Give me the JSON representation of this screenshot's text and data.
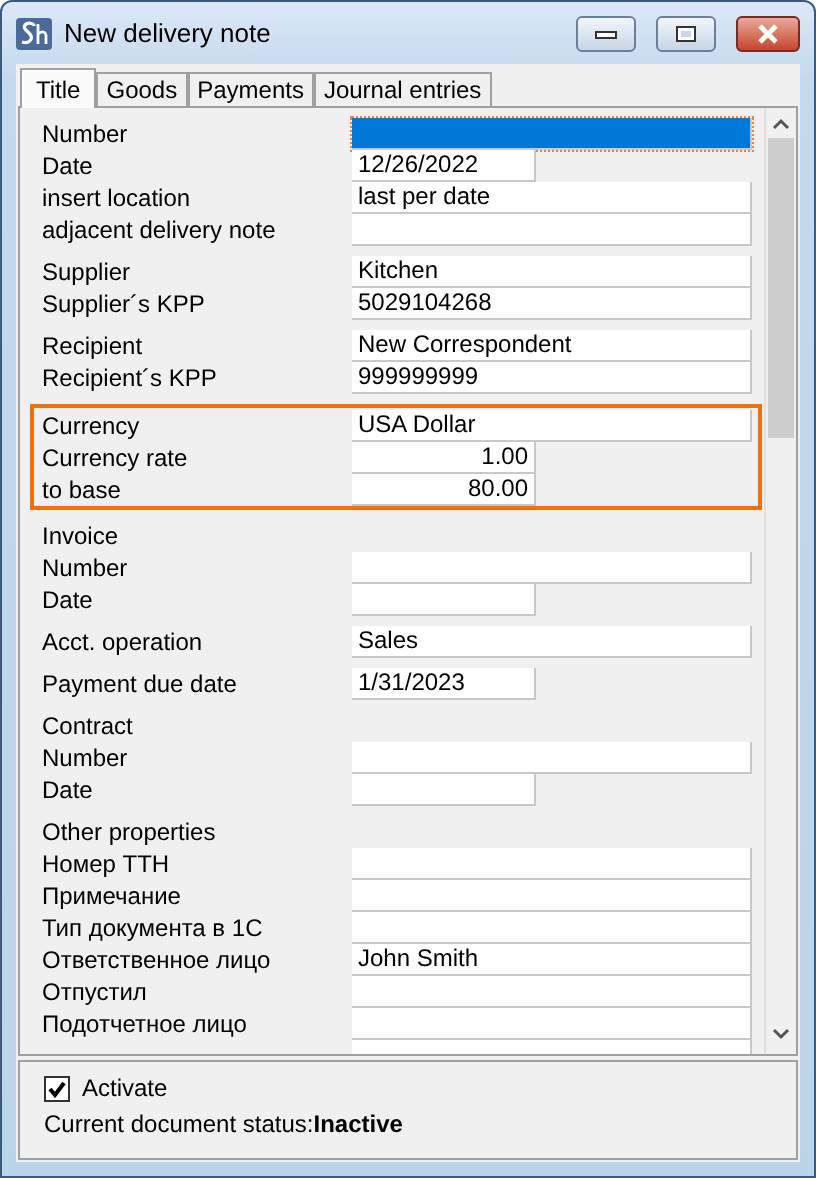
{
  "window": {
    "title": "New delivery note"
  },
  "tabs": [
    {
      "label": "Title",
      "selected": true
    },
    {
      "label": "Goods",
      "selected": false
    },
    {
      "label": "Payments",
      "selected": false
    },
    {
      "label": "Journal entries",
      "selected": false
    }
  ],
  "groups": [
    {
      "highlighted": false,
      "rows": [
        {
          "label": "Number",
          "value": "",
          "kind": "wide",
          "focused": true
        },
        {
          "label": "Date",
          "value": "12/26/2022",
          "kind": "short",
          "focused": false
        },
        {
          "label": "insert location",
          "value": "last per date",
          "kind": "wide",
          "focused": false
        },
        {
          "label": "adjacent delivery note",
          "value": "",
          "kind": "wide",
          "focused": false
        }
      ]
    },
    {
      "highlighted": false,
      "rows": [
        {
          "label": "Supplier",
          "value": "Kitchen",
          "kind": "wide",
          "focused": false
        },
        {
          "label": "Supplier´s KPP",
          "value": "5029104268",
          "kind": "wide",
          "focused": false
        }
      ]
    },
    {
      "highlighted": false,
      "rows": [
        {
          "label": "Recipient",
          "value": "New Correspondent",
          "kind": "wide",
          "focused": false
        },
        {
          "label": "Recipient´s KPP",
          "value": "999999999",
          "kind": "wide",
          "focused": false
        }
      ]
    },
    {
      "highlighted": true,
      "rows": [
        {
          "label": "Currency",
          "value": "USA Dollar",
          "kind": "wide",
          "focused": false
        },
        {
          "label": "Currency rate",
          "value": "1.00",
          "kind": "number",
          "focused": false
        },
        {
          "label": "to base",
          "value": "80.00",
          "kind": "number",
          "focused": false
        }
      ]
    },
    {
      "highlighted": false,
      "heading": "Invoice",
      "rows": [
        {
          "label": "Number",
          "value": "",
          "kind": "wide",
          "focused": false
        },
        {
          "label": "Date",
          "value": "",
          "kind": "short",
          "focused": false
        }
      ]
    },
    {
      "highlighted": false,
      "rows": [
        {
          "label": "Acct. operation",
          "value": "Sales",
          "kind": "wide",
          "focused": false
        }
      ]
    },
    {
      "highlighted": false,
      "rows": [
        {
          "label": "Payment due date",
          "value": "1/31/2023",
          "kind": "short",
          "focused": false
        }
      ]
    },
    {
      "highlighted": false,
      "heading": "Contract",
      "rows": [
        {
          "label": "Number",
          "value": "",
          "kind": "wide",
          "focused": false
        },
        {
          "label": "Date",
          "value": "",
          "kind": "short",
          "focused": false
        }
      ]
    },
    {
      "highlighted": false,
      "heading": "Other properties",
      "rows": [
        {
          "label": "Номер ТТН",
          "value": "",
          "kind": "wide",
          "focused": false
        },
        {
          "label": "Примечание",
          "value": "",
          "kind": "wide",
          "focused": false
        },
        {
          "label": "Тип документа в 1С",
          "value": "",
          "kind": "wide",
          "focused": false
        },
        {
          "label": "Ответственное лицо",
          "value": "John Smith",
          "kind": "wide",
          "focused": false
        },
        {
          "label": "Отпустил",
          "value": "",
          "kind": "wide",
          "focused": false
        },
        {
          "label": "Подотчетное лицо",
          "value": "",
          "kind": "wide",
          "focused": false
        },
        {
          "value": "",
          "kind": "wide",
          "focused": false
        }
      ]
    }
  ],
  "activate": {
    "label": "Activate",
    "checked": true
  },
  "status": {
    "label": "Current document status:",
    "value": "Inactive"
  }
}
